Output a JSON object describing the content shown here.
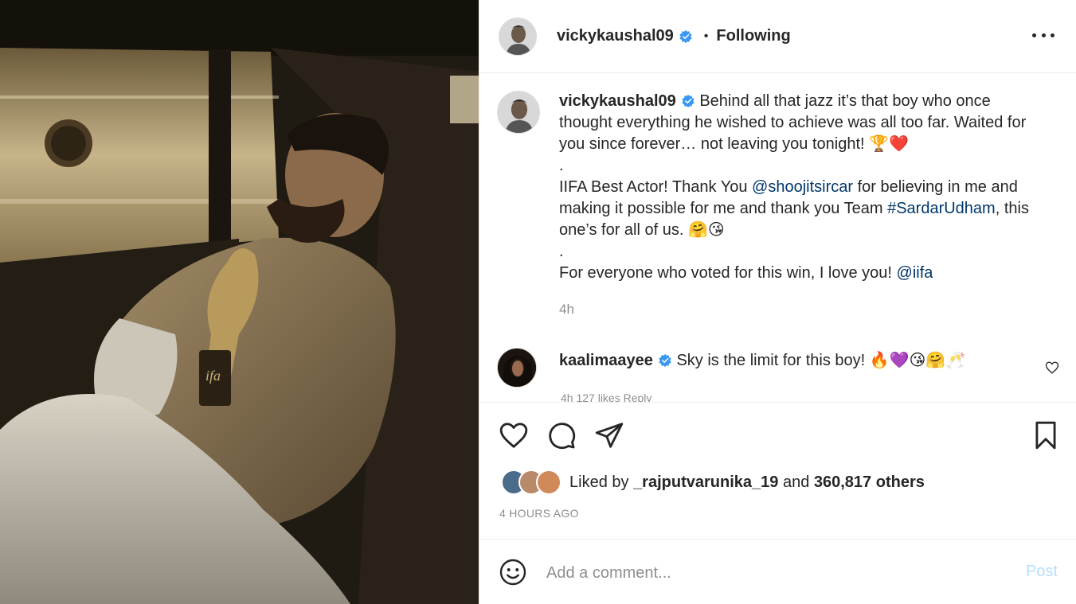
{
  "post": {
    "username": "vickykaushal09",
    "follow_dot": "•",
    "follow_status": "Following"
  },
  "caption": {
    "username": "vickykaushal09",
    "line1": "Behind all that jazz it’s that boy who once thought everything he wished to achieve was all too far. Waited for you since forever… not leaving you tonight! 🏆❤️",
    "sep1": ".",
    "line2_a": "IIFA Best Actor! Thank You ",
    "mention1": "@shoojitsircar",
    "line2_b": " for believing in me and making it possible for me and thank you Team ",
    "hashtag": "#SardarUdham",
    "line2_c": ", this one’s for all of us. 🤗😘",
    "sep2": ".",
    "line3_a": "For everyone who voted for this win, I love you! ",
    "mention2": "@iifa",
    "time": "4h"
  },
  "comment": {
    "username": "kaalimaayee",
    "text": "Sky is the limit for this boy! 🔥💜😘🤗🥂",
    "meta": "4h   127 likes   Reply"
  },
  "likes": {
    "prefix": "Liked by ",
    "user": "_rajputvarunika_19",
    "mid": " and ",
    "count": "360,817 others"
  },
  "timestamp": "4 HOURS AGO",
  "add_comment": {
    "placeholder": "Add a comment...",
    "post_label": "Post"
  },
  "colors": {
    "link": "#00376b",
    "verified": "#3897f0",
    "post_disabled": "#b2dffc"
  },
  "icons": [
    "heart-icon",
    "comment-icon",
    "share-icon",
    "bookmark-icon",
    "emoji-icon",
    "more-icon",
    "verified-icon"
  ]
}
